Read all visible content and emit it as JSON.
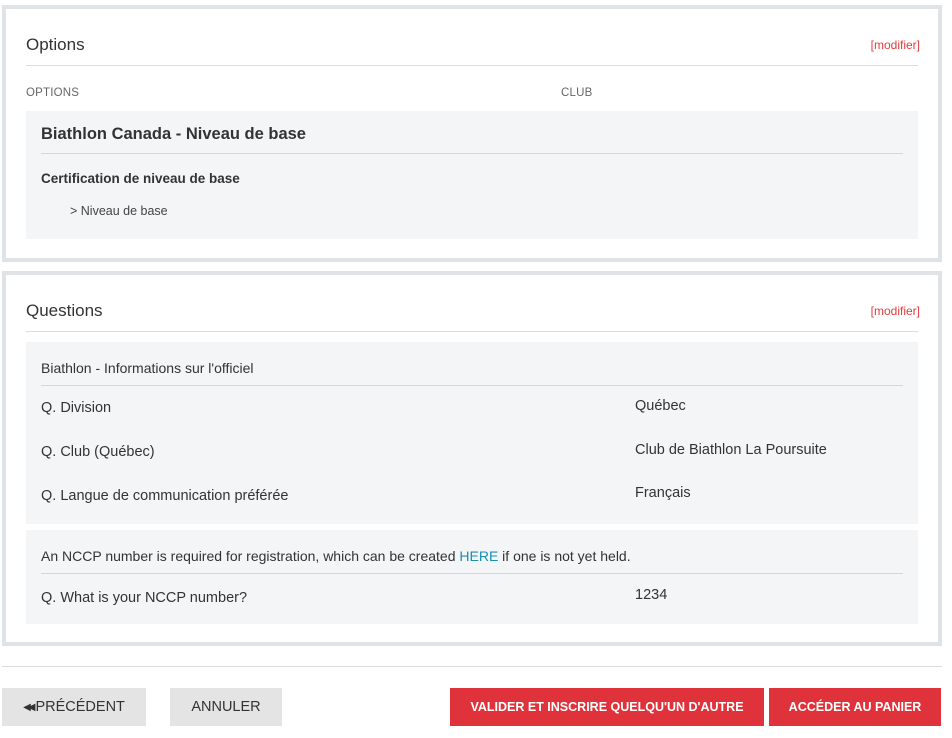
{
  "options_panel": {
    "title": "Options",
    "modify_label": "[modifier]",
    "column_options": "OPTIONS",
    "column_club": "CLUB",
    "option_title": "Biathlon Canada - Niveau de base",
    "option_subtitle": "Certification de niveau de base",
    "option_item": "> Niveau de base"
  },
  "questions_panel": {
    "title": "Questions",
    "modify_label": "[modifier]",
    "section_title": "Biathlon - Informations sur l'officiel",
    "questions": [
      {
        "label": "Q. Division",
        "answer": "Québec"
      },
      {
        "label": "Q. Club (Québec)",
        "answer": "Club de Biathlon La Poursuite"
      },
      {
        "label": "Q. Langue de communication préférée",
        "answer": "Français"
      }
    ],
    "nccp_note_before": "An NCCP number is required for registration, which can be created ",
    "nccp_link": "HERE",
    "nccp_note_after": " if one is not yet held.",
    "nccp_question": {
      "label": "Q. What is your NCCP number?",
      "answer": "1234"
    }
  },
  "footer": {
    "prev_label": "PRÉCÉDENT",
    "cancel_label": "ANNULER",
    "validate_label": "VALIDER ET INSCRIRE QUELQU'UN D'AUTRE",
    "cart_label": "ACCÉDER AU PANIER"
  },
  "colors": {
    "accent_red": "#e0323a",
    "link_blue": "#1a8fb0",
    "panel_border": "#dfe3e5"
  }
}
